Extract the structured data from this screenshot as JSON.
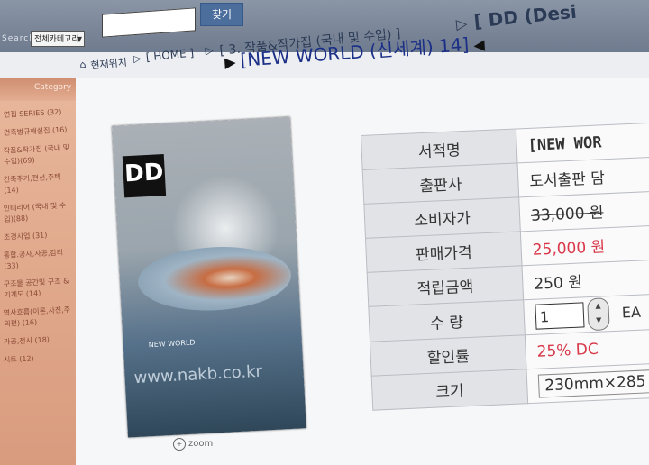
{
  "search": {
    "label": "Search",
    "category": "전체카테고리",
    "button": "찾기"
  },
  "breadcrumb": {
    "location_icon": "home-icon",
    "location": "현재위치",
    "home": "[ HOME ]",
    "category": "[ 3. 작품&작가집 (국내 및 수입) ]",
    "top_category": "[ DD (Desi"
  },
  "product_title": "[NEW WORLD (신세계) 14]",
  "sidebar": {
    "header": "Category",
    "items": [
      "연집 SERIES (32)",
      "건축법규해설집 (16)",
      "작품&작가집 (국내 및 수입)(69)",
      "건축주거,편선,주택 (14)",
      "인테리어 (국내 및 수입)(88)",
      "조경사업 (31)",
      "통합.공사,사공,감리 (33)",
      "구조물 공간및 구조 & 기계도 (14)",
      "역사흐름(이론,사진,주의편) (16)",
      "가공,전시 (18)",
      "시트 (12)"
    ]
  },
  "cover": {
    "logo": "DD",
    "subtitle": "NEW WORLD",
    "watermark": "www.nakb.co.kr",
    "zoom": "zoom"
  },
  "info": {
    "rows": [
      {
        "label": "서적명",
        "value": "[NEW WOR"
      },
      {
        "label": "출판사",
        "value": "도서출판 담"
      },
      {
        "label": "소비자가",
        "value": "33,000 원"
      },
      {
        "label": "판매가격",
        "value": "25,000 원"
      },
      {
        "label": "적립금액",
        "value": "250 원"
      },
      {
        "label": "수 량",
        "value": "1",
        "unit": "EA"
      },
      {
        "label": "할인률",
        "value": "25% DC"
      },
      {
        "label": "크기",
        "value": "230mm×285"
      }
    ]
  },
  "colors": {
    "sale_price": "#d8384a",
    "title": "#1b2f87",
    "sidebar": "#e0a98b"
  }
}
